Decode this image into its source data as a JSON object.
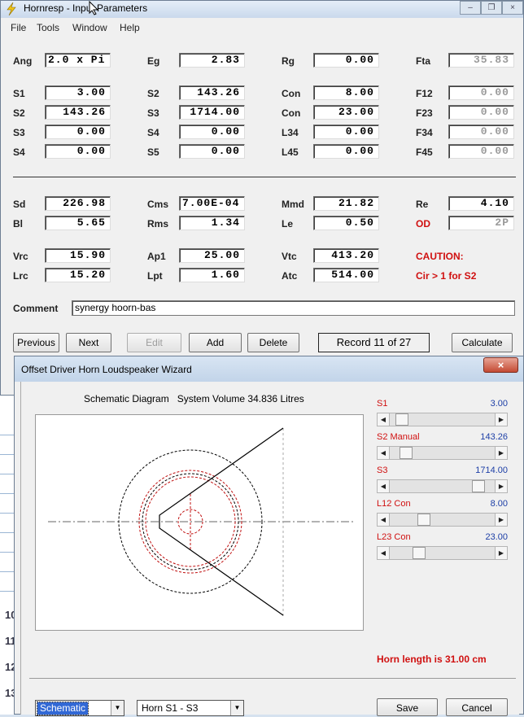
{
  "main_window": {
    "title": "Hornresp - Input Parameters",
    "controls": [
      "–",
      "❐",
      "×"
    ],
    "menu": [
      "File",
      "Tools",
      "Window",
      "Help"
    ],
    "params": [
      {
        "label": "Ang",
        "value": "2.0 x Pi"
      },
      {
        "label": "Eg",
        "value": "2.83"
      },
      {
        "label": "Rg",
        "value": "0.00"
      },
      {
        "label": "Fta",
        "value": "35.83"
      },
      {
        "label": "S1",
        "value": "3.00"
      },
      {
        "label": "S2",
        "value": "143.26"
      },
      {
        "label": "Con",
        "value": "8.00"
      },
      {
        "label": "F12",
        "value": "0.00"
      },
      {
        "label": "S2",
        "value": "143.26"
      },
      {
        "label": "S3",
        "value": "1714.00"
      },
      {
        "label": "Con",
        "value": "23.00"
      },
      {
        "label": "F23",
        "value": "0.00"
      },
      {
        "label": "S3",
        "value": "0.00"
      },
      {
        "label": "S4",
        "value": "0.00"
      },
      {
        "label": "L34",
        "value": "0.00"
      },
      {
        "label": "F34",
        "value": "0.00"
      },
      {
        "label": "S4",
        "value": "0.00"
      },
      {
        "label": "S5",
        "value": "0.00"
      },
      {
        "label": "L45",
        "value": "0.00"
      },
      {
        "label": "F45",
        "value": "0.00"
      },
      {
        "label": "Sd",
        "value": "226.98"
      },
      {
        "label": "Cms",
        "value": "7.00E-04"
      },
      {
        "label": "Mmd",
        "value": "21.82"
      },
      {
        "label": "Re",
        "value": "4.10"
      },
      {
        "label": "Bl",
        "value": "5.65"
      },
      {
        "label": "Rms",
        "value": "1.34"
      },
      {
        "label": "Le",
        "value": "0.50"
      },
      {
        "label": "OD",
        "value": "2P"
      },
      {
        "label": "Vrc",
        "value": "15.90"
      },
      {
        "label": "Ap1",
        "value": "25.00"
      },
      {
        "label": "Vtc",
        "value": "413.20"
      },
      {
        "label": "Lrc",
        "value": "15.20"
      },
      {
        "label": "Lpt",
        "value": "1.60"
      },
      {
        "label": "Atc",
        "value": "514.00"
      }
    ],
    "caution_title": "CAUTION:",
    "caution_text": "Cir > 1 for S2",
    "comment_label": "Comment",
    "comment_value": "synergy hoorn-bas",
    "buttons": {
      "previous": "Previous",
      "next": "Next",
      "edit": "Edit",
      "add": "Add",
      "delete": "Delete",
      "calculate": "Calculate"
    },
    "record": "Record 11 of 27"
  },
  "background_window": {
    "row_numbers": [
      "10",
      "11",
      "12",
      "13"
    ]
  },
  "wizard": {
    "title": "Offset Driver Horn Loudspeaker Wizard",
    "close": "×",
    "diagram_title": "Schematic Diagram",
    "system_volume": "System Volume 34.836 Litres",
    "sliders": [
      {
        "label": "S1",
        "value": "3.00",
        "position": 0.05
      },
      {
        "label": "S2  Manual",
        "value": "143.26",
        "position": 0.1
      },
      {
        "label": "S3",
        "value": "1714.00",
        "position": 0.9
      },
      {
        "label": "L12  Con",
        "value": "8.00",
        "position": 0.3
      },
      {
        "label": "L23  Con",
        "value": "23.00",
        "position": 0.24
      }
    ],
    "horn_length": "Horn length is 31.00 cm",
    "view_select": "Schematic",
    "horn_select": "Horn S1 - S3",
    "save": "Save",
    "cancel": "Cancel",
    "colors": {
      "accent_red": "#d01010",
      "value_blue": "#1c3ea6"
    }
  }
}
